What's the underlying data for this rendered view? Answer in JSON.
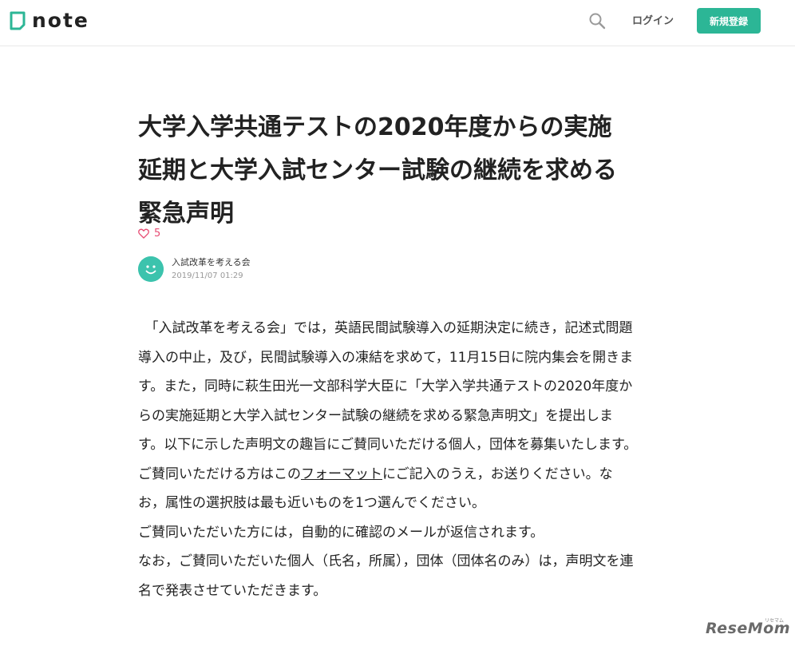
{
  "header": {
    "logo_text": "note",
    "login_label": "ログイン",
    "signup_label": "新規登録"
  },
  "article": {
    "title": "大学入学共通テストの2020年度からの実施延期と大学入試センター試験の継続を求める緊急声明",
    "like_count": "5",
    "author_name": "入試改革を考える会",
    "post_date": "2019/11/07 01:29",
    "body": {
      "p1_before_link": "「入試改革を考える会」では，英語民間試験導入の延期決定に続き，記述式問題導入の中止，及び，民間試験導入の凍結を求めて，11月15日に院内集会を開きます。また，同時に萩生田光一文部科学大臣に「大学入学共通テストの2020年度からの実施延期と大学入試センター試験の継続を求める緊急声明文」を提出します。以下に示した声明文の趣旨にご賛同いただける個人，団体を募集いたします。ご賛同いただける方はこの",
      "p1_link": "フォーマット",
      "p1_after_link": "にご記入のうえ，お送りください。なお，属性の選択肢は最も近いものを1つ選んでください。",
      "p2": "ご賛同いただいた方には，自動的に確認のメールが返信されます。",
      "p3": "なお，ご賛同いただいた個人（氏名，所属），団体（団体名のみ）は，声明文を連名で発表させていただきます。"
    }
  },
  "watermark": {
    "text": "ReseMom",
    "small_text": "リセマム"
  },
  "icons": {
    "logo": "note-logo-icon",
    "search": "search-icon",
    "heart": "heart-icon",
    "avatar": "smiley-avatar"
  },
  "colors": {
    "brand": "#2cb696",
    "heart": "#e74c73",
    "avatar": "#3cc3ad"
  }
}
